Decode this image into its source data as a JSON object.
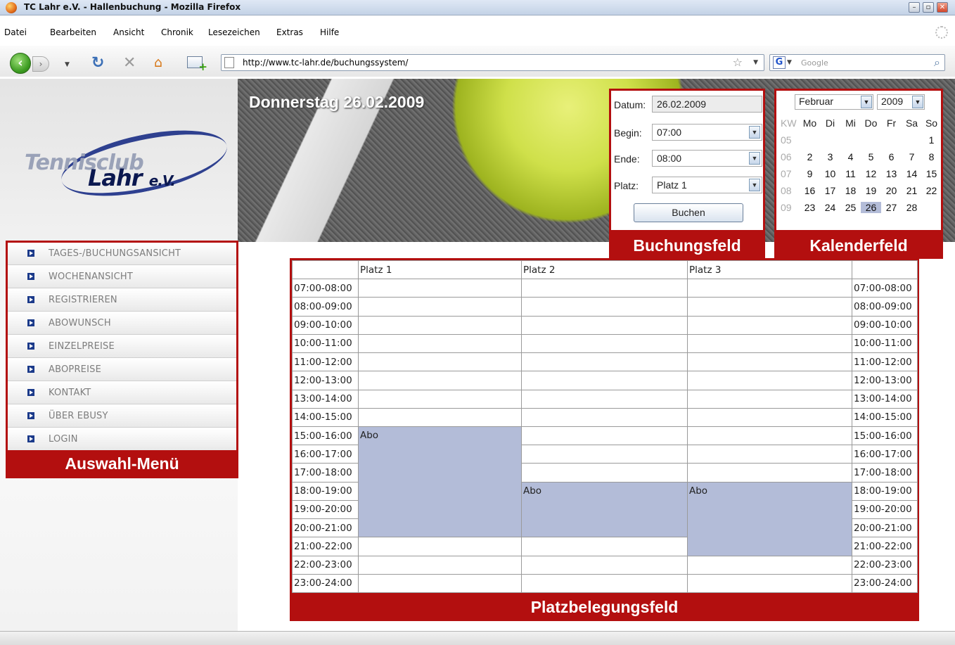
{
  "window": {
    "title": "TC Lahr e.V. - Hallenbuchung - Mozilla Firefox"
  },
  "menubar": [
    "Datei",
    "Bearbeiten",
    "Ansicht",
    "Chronik",
    "Lesezeichen",
    "Extras",
    "Hilfe"
  ],
  "toolbar": {
    "url": "http://www.tc-lahr.de/buchungssystem/",
    "search_placeholder": "Google"
  },
  "header": {
    "logo_line1": "Tennisclub",
    "logo_line2": "Lahr",
    "logo_suffix": "e.V.",
    "date_heading": "Donnerstag 26.02.2009"
  },
  "booking": {
    "date_label": "Datum:",
    "date_value": "26.02.2009",
    "begin_label": "Begin:",
    "begin_value": "07:00",
    "end_label": "Ende:",
    "end_value": "08:00",
    "court_label": "Platz:",
    "court_value": "Platz 1",
    "submit_label": "Buchen",
    "panel_label": "Buchungsfeld"
  },
  "calendar": {
    "month": "Februar",
    "year": "2009",
    "kw_header": "KW",
    "weekday_headers": [
      "Mo",
      "Di",
      "Mi",
      "Do",
      "Fr",
      "Sa",
      "So"
    ],
    "weeks": [
      {
        "kw": "05",
        "days": [
          "",
          "",
          "",
          "",
          "",
          "",
          "1"
        ]
      },
      {
        "kw": "06",
        "days": [
          "2",
          "3",
          "4",
          "5",
          "6",
          "7",
          "8"
        ]
      },
      {
        "kw": "07",
        "days": [
          "9",
          "10",
          "11",
          "12",
          "13",
          "14",
          "15"
        ]
      },
      {
        "kw": "08",
        "days": [
          "16",
          "17",
          "18",
          "19",
          "20",
          "21",
          "22"
        ]
      },
      {
        "kw": "09",
        "days": [
          "23",
          "24",
          "25",
          "26",
          "27",
          "28",
          ""
        ]
      }
    ],
    "selected_day": "26",
    "panel_label": "Kalenderfeld"
  },
  "menu": {
    "items": [
      "TAGES-/BUCHUNGSANSICHT",
      "WOCHENANSICHT",
      "REGISTRIEREN",
      "ABOWUNSCH",
      "EINZELPREISE",
      "ABOPREISE",
      "KONTAKT",
      "ÜBER EBUSY",
      "LOGIN"
    ],
    "panel_label": "Auswahl-Menü"
  },
  "schedule": {
    "courts": [
      "Platz 1",
      "Platz 2",
      "Platz 3"
    ],
    "slots": [
      "07:00-08:00",
      "08:00-09:00",
      "09:00-10:00",
      "10:00-11:00",
      "11:00-12:00",
      "12:00-13:00",
      "13:00-14:00",
      "14:00-15:00",
      "15:00-16:00",
      "16:00-17:00",
      "17:00-18:00",
      "18:00-19:00",
      "19:00-20:00",
      "20:00-21:00",
      "21:00-22:00",
      "22:00-23:00",
      "23:00-24:00"
    ],
    "bookings": [
      {
        "court": 0,
        "start": "15:00-16:00",
        "slots": 6,
        "label": "Abo"
      },
      {
        "court": 1,
        "start": "18:00-19:00",
        "slots": 3,
        "label": "Abo"
      },
      {
        "court": 2,
        "start": "18:00-19:00",
        "slots": 4,
        "label": "Abo"
      }
    ],
    "booking_color": "#b3bcd8",
    "panel_label": "Platzbelegungsfeld"
  },
  "accent_color": "#b30f0f"
}
